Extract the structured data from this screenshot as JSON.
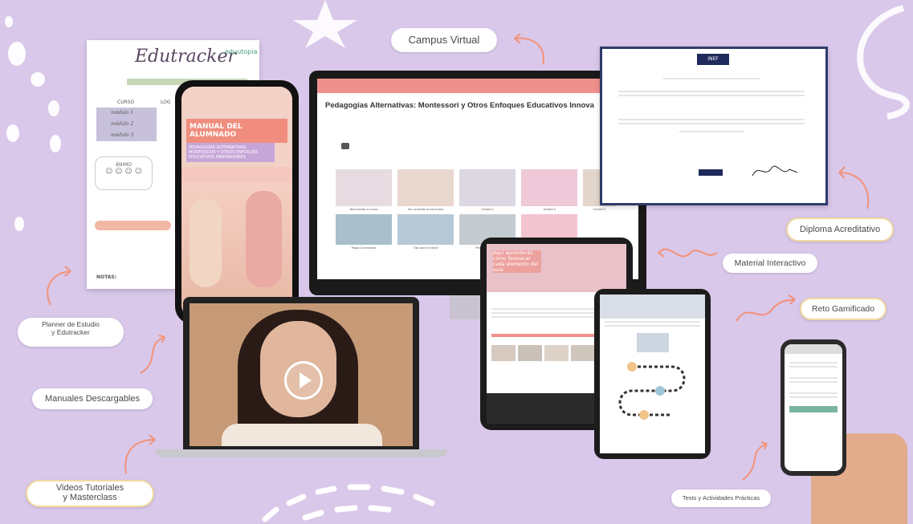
{
  "labels": {
    "campus": "Campus Virtual",
    "diploma": "Diploma Acreditativo",
    "material": "Material Interactivo",
    "reto": "Reto Gamificado",
    "planner": "Planner de Estudio\ny Edutracker",
    "manuales": "Manuales Descargables",
    "videos": "Videos Tutoriales\ny Masterclass",
    "tests": "Tests y Actividades Prácticas"
  },
  "planner": {
    "brand": "Edutracker",
    "logo": "eduutopia",
    "col1": "CURSO",
    "col2": "LOG",
    "rows": [
      "módulo 1",
      "módulo 2",
      "módulo 3"
    ],
    "mood": "ÁNIMO",
    "notes": "NOTAS:"
  },
  "phone": {
    "title": "MANUAL DEL ALUMNADO",
    "subtitle": "PEDAGOGÍAS ALTERNATIVAS: MONTESSORI Y OTROS ENFOQUES EDUCATIVOS INNOVADORES"
  },
  "monitor": {
    "course_title": "Pedagogías Alternativas: Montessori y Otros Enfoques Educativos Innova",
    "captions": [
      "Bienvenida al curso",
      "Sin conexión al escenario",
      "Unidad 1",
      "Unidad 2",
      "Unidad 3",
      "Mapa Conceptual",
      "Tips para la salud",
      "Pon tus Prácticas"
    ]
  },
  "tablet1": {
    "heading": "Aquí aprenderás cómo favorecer cada elemento del aula"
  },
  "diploma": {
    "logo": "INEF"
  },
  "colors": {
    "bg": "#d9c8ea",
    "accent": "#f0908c",
    "gold": "#f2d9a0"
  }
}
